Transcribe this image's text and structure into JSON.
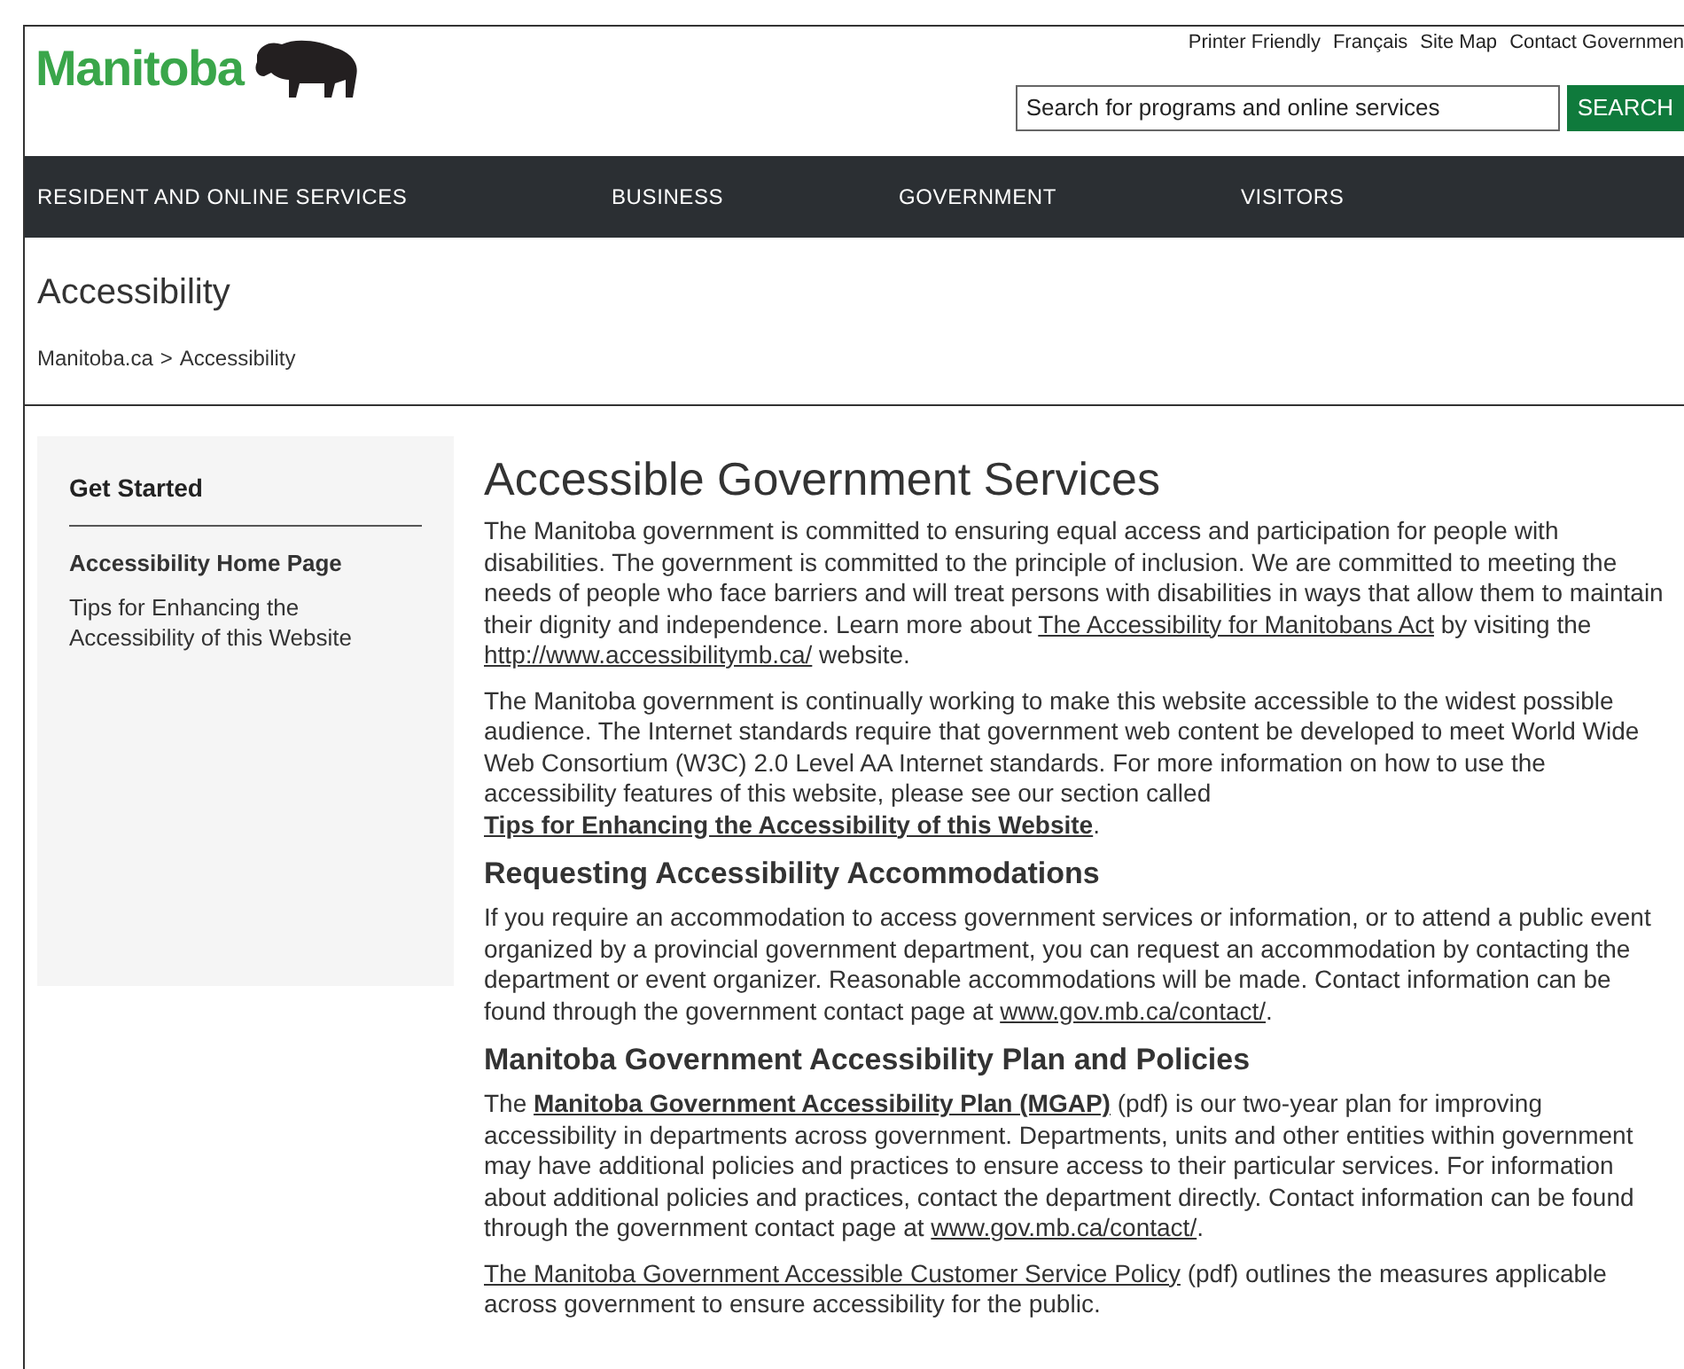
{
  "logo": {
    "wordmark": "Manitoba"
  },
  "utility_links": [
    "Printer Friendly",
    "Français",
    "Site Map",
    "Contact Governmen"
  ],
  "search": {
    "placeholder": "Search for programs and online services",
    "button": "SEARCH"
  },
  "nav": [
    "RESIDENT AND ONLINE SERVICES",
    "BUSINESS",
    "GOVERNMENT",
    "VISITORS"
  ],
  "page_title": "Accessibility",
  "breadcrumb": {
    "items": [
      "Manitoba.ca",
      "Accessibility"
    ],
    "separator": ">"
  },
  "sidebar": {
    "title": "Get Started",
    "items": [
      {
        "label": "Accessibility Home Page",
        "selected": true
      },
      {
        "label": "Tips for Enhancing the Accessibility of this Website",
        "selected": false
      }
    ]
  },
  "content": [
    {
      "kind": "h1",
      "text": "Accessible Government Services"
    },
    {
      "kind": "p",
      "segments": [
        {
          "kind": "text",
          "text": "The Manitoba government is committed to ensuring equal access and participation for people with disabilities. The government is committed to the principle of inclusion. We are committed to meeting the needs of people who face barriers and will treat persons with disabilities in ways that allow them to maintain their dignity and independence. Learn more about "
        },
        {
          "kind": "link",
          "text": "The Accessibility for Manitobans Act"
        },
        {
          "kind": "text",
          "text": " by visiting the "
        },
        {
          "kind": "link",
          "text": "http://www.accessibilitymb.ca/"
        },
        {
          "kind": "text",
          "text": " website."
        }
      ]
    },
    {
      "kind": "p",
      "segments": [
        {
          "kind": "text",
          "text": "The Manitoba government is continually working to make this website accessible to the widest possible audience. The Internet standards require that government web content be developed to meet World Wide Web Consortium (W3C) 2.0 Level AA Internet standards. For more information on how to use the accessibility features of this website, please see our section called "
        },
        {
          "kind": "bold_link",
          "text": "Tips for Enhancing the Accessibility of this Website"
        },
        {
          "kind": "text",
          "text": "."
        }
      ]
    },
    {
      "kind": "h2",
      "text": "Requesting Accessibility Accommodations"
    },
    {
      "kind": "p",
      "segments": [
        {
          "kind": "text",
          "text": "If you require an accommodation to access government services or information, or to attend a public event organized by a provincial government department, you can request an accommodation by contacting the department or event organizer. Reasonable accommodations will be made. Contact information can be found through the government contact page at "
        },
        {
          "kind": "link",
          "text": "www.gov.mb.ca/contact/"
        },
        {
          "kind": "text",
          "text": "."
        }
      ]
    },
    {
      "kind": "h2",
      "text": "Manitoba Government Accessibility Plan and Policies"
    },
    {
      "kind": "p",
      "segments": [
        {
          "kind": "text",
          "text": "The "
        },
        {
          "kind": "bold_link",
          "text": "Manitoba Government Accessibility Plan (MGAP)"
        },
        {
          "kind": "text",
          "text": " (pdf) is our two-year plan for improving accessibility in departments across government. Departments, units and other entities within government may have additional policies and practices to ensure access to their particular services. For information about additional policies and practices, contact the department directly. Contact information can be found through the government contact page at "
        },
        {
          "kind": "link",
          "text": "www.gov.mb.ca/contact/"
        },
        {
          "kind": "text",
          "text": "."
        }
      ]
    },
    {
      "kind": "p",
      "segments": [
        {
          "kind": "link",
          "text": "The Manitoba Government Accessible Customer Service Policy"
        },
        {
          "kind": "text",
          "text": " (pdf) outlines the measures applicable across government to ensure accessibility for the public."
        }
      ]
    }
  ]
}
